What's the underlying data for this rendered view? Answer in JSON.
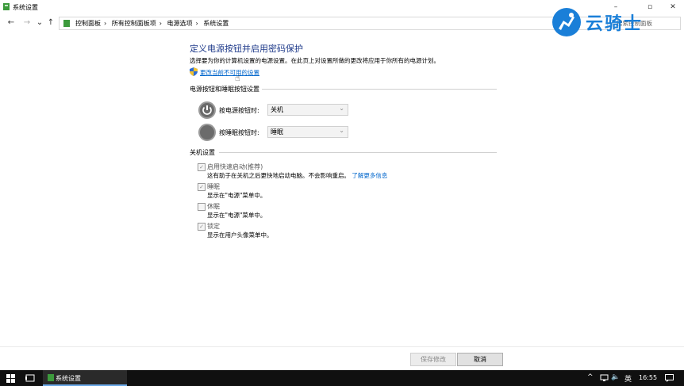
{
  "window": {
    "title": "系统设置",
    "min_icon": "minimize-icon",
    "max_icon": "maximize-icon",
    "close_icon": "close-icon"
  },
  "nav": {
    "back": "←",
    "forward": "→",
    "recent": "⌄",
    "up": "↑"
  },
  "breadcrumb": [
    "控制面板",
    "所有控制面板项",
    "电源选项",
    "系统设置"
  ],
  "search": {
    "placeholder": "搜索控制面板"
  },
  "logo": {
    "text": "云骑士"
  },
  "content": {
    "heading": "定义电源按钮并启用密码保护",
    "subtitle": "选择要为你的计算机设置的电源设置。在此页上对设置所做的更改将应用于你所有的电源计划。",
    "change_link": "更改当前不可用的设置",
    "power_section": {
      "title": "电源按钮和睡眠按钮设置",
      "rows": [
        {
          "label": "按电源按钮时:",
          "value": "关机"
        },
        {
          "label": "按睡眠按钮时:",
          "value": "睡眠"
        }
      ]
    },
    "shutdown_section": {
      "title": "关机设置",
      "options": [
        {
          "title": "启用快速启动(推荐)",
          "desc": "这有助于在关机之后更快地启动电脑。不会影响重启。",
          "link": "了解更多信息",
          "checked": true
        },
        {
          "title": "睡眠",
          "desc": "显示在\"电源\"菜单中。",
          "checked": true
        },
        {
          "title": "休眠",
          "desc": "显示在\"电源\"菜单中。",
          "checked": false
        },
        {
          "title": "锁定",
          "desc": "显示在用户头像菜单中。",
          "checked": true
        }
      ]
    }
  },
  "buttons": {
    "save": "保存修改",
    "cancel": "取消"
  },
  "taskbar": {
    "app_label": "系统设置",
    "ime": "英",
    "time": "16:55"
  },
  "colors": {
    "link": "#0066cc",
    "heading": "#1e3a8a",
    "logo": "#1a7fd8",
    "taskbar": "#101010"
  }
}
